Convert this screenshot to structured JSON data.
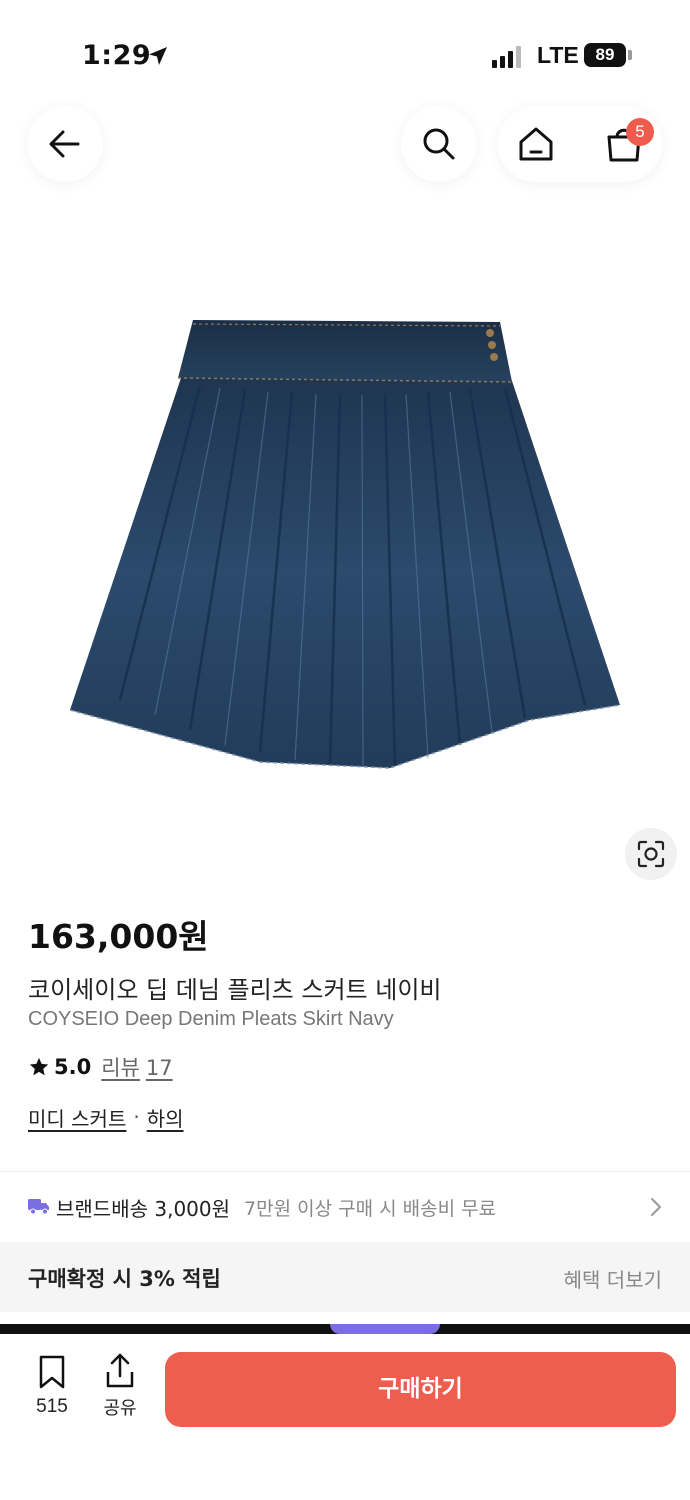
{
  "status_bar": {
    "time": "1:29",
    "network": "LTE",
    "battery": "89"
  },
  "nav": {
    "back_icon": "arrow-left-icon",
    "search_icon": "search-icon",
    "home_icon": "home-icon",
    "cart_icon": "shopping-bag-icon",
    "cart_badge": "5"
  },
  "product": {
    "price": "163,000원",
    "title_ko": "코이세이오 딥 데님 플리츠 스커트 네이비",
    "title_en": "COYSEIO Deep Denim Pleats Skirt Navy",
    "rating": "5.0",
    "review_label": "리뷰",
    "review_count": "17",
    "category_primary": "미디 스커트",
    "category_separator": "·",
    "category_secondary": "하의"
  },
  "shipping": {
    "label": "브랜드배송 3,000원",
    "note": "7만원 이상 구매 시 배송비 무료"
  },
  "benefit": {
    "label": "구매확정 시 3% 적립",
    "more": "혜택 더보기"
  },
  "bottom_bar": {
    "bookmark_count": "515",
    "share_label": "공유",
    "buy_label": "구매하기"
  },
  "colors": {
    "accent": "#ee5e4f",
    "badge": "#ef5b4c",
    "truck": "#7b6ee0"
  }
}
